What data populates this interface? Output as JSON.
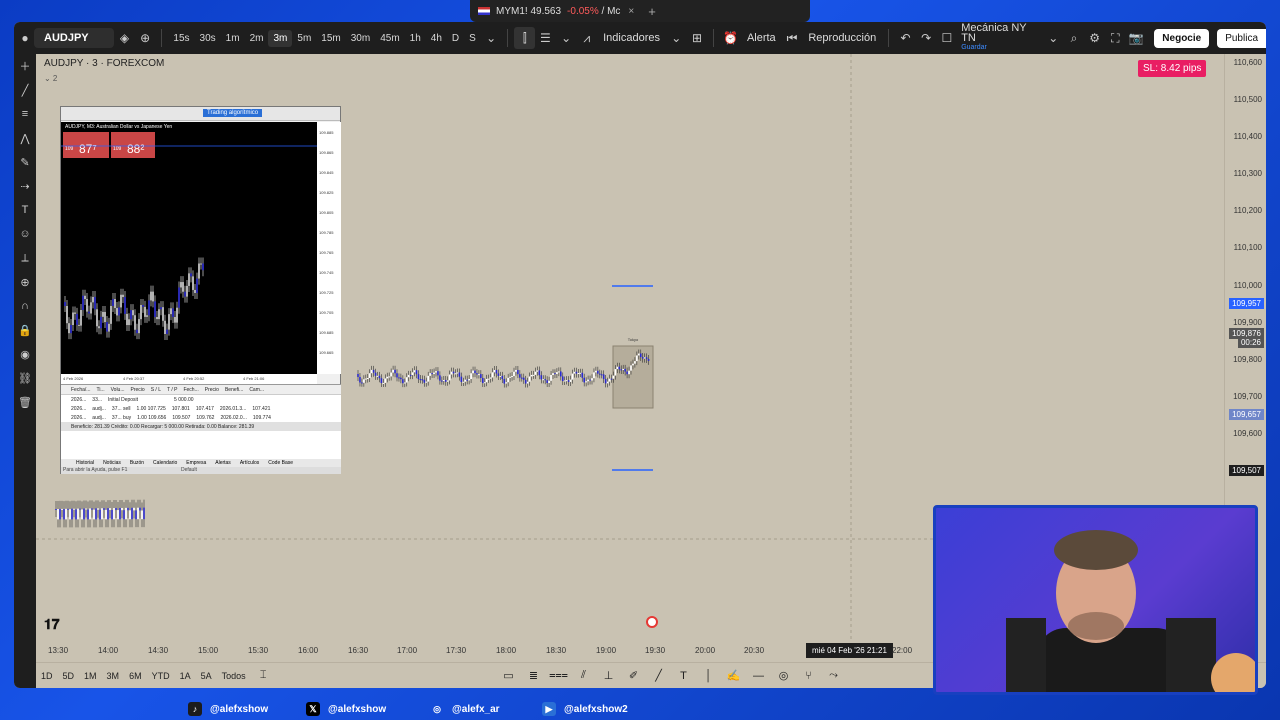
{
  "browser_tab": {
    "title": "MYM1!",
    "price": "49.563",
    "change": "-0.05%",
    "extra": "/ Mc",
    "close": "×",
    "new_tab": "+"
  },
  "toolbar": {
    "symbol": "AUDJPY",
    "timeframes": [
      "15s",
      "30s",
      "1m",
      "2m",
      "3m",
      "5m",
      "15m",
      "30m",
      "45m",
      "1h",
      "4h",
      "D",
      "S"
    ],
    "active_timeframe_index": 4,
    "indicators_label": "Indicadores",
    "alert_label": "Alerta",
    "replay_label": "Reproducción",
    "layout_name": "Mecánica NY TN",
    "layout_sub": "Guardar",
    "trade_label": "Negocie",
    "publish_label": "Publica"
  },
  "chart": {
    "legend": "AUDJPY · 3 · FOREXCOM",
    "legend_sub": "⌄ 2",
    "sl_badge": "SL: 8.42 pips",
    "session_label": "Tokyo",
    "accent_color": "#2962ff",
    "badge_color": "#e91e63"
  },
  "price_axis": {
    "labels": [
      "110,600",
      "110,500",
      "110,400",
      "110,300",
      "110,200",
      "110,100",
      "110,000",
      "109,900",
      "109,800",
      "109,700",
      "109,600"
    ],
    "tags": [
      {
        "text": "109,957",
        "color": "#2962ff"
      },
      {
        "text": "109,876",
        "color": "#555555"
      },
      {
        "text": "00:26",
        "color": "#555555"
      },
      {
        "text": "109,657",
        "color": "#6f86c9"
      },
      {
        "text": "109,507",
        "color": "#1e1e1e"
      }
    ]
  },
  "time_axis": {
    "labels": [
      "13:30",
      "14:00",
      "14:30",
      "15:00",
      "15:30",
      "16:00",
      "16:30",
      "17:00",
      "17:30",
      "18:00",
      "18:30",
      "19:00",
      "19:30",
      "20:00",
      "20:30",
      "22:00"
    ],
    "cursor_label": "mié 04 Feb '26   21:21"
  },
  "bottom_bar": {
    "ranges": [
      "1D",
      "5D",
      "1M",
      "3M",
      "6M",
      "YTD",
      "1A",
      "5A",
      "Todos"
    ]
  },
  "mt4": {
    "algo_button": "Trading algorítmico",
    "chart_title": "AUDJPY, M3: Australian Dollar vs Japanese Yen",
    "sell_label": "SELL",
    "buy_label": "BUY",
    "lot": "1.00",
    "sell_price_small": "109",
    "sell_price_big": "87⁷",
    "buy_price_small": "109",
    "buy_price_big": "88²",
    "axis": [
      "109.885",
      "109.865",
      "109.845",
      "109.825",
      "109.805",
      "109.785",
      "109.765",
      "109.745",
      "109.725",
      "109.705",
      "109.685",
      "109.665"
    ],
    "time_labels": [
      "4 Feb 2026",
      "4 Feb 20:37",
      "4 Feb 20:52",
      "4 Feb 21:06"
    ],
    "term_headers": [
      "Fecha/...",
      "Ti...",
      "Volu...",
      "Precio",
      "S / L",
      "T / P",
      "Fech...",
      "Precio",
      "Benefi...",
      "Cam..."
    ],
    "rows": [
      [
        "2026...",
        "33...",
        "Initial Deposit",
        "",
        "",
        "",
        "",
        "",
        "5 000.00",
        ""
      ],
      [
        "2026...",
        "audj...",
        "37... sell",
        "1.00 107.725",
        "107.801",
        "107.417",
        "2026.01.3...",
        "107.421",
        "",
        ""
      ],
      [
        "2026...",
        "audj...",
        "37... buy",
        "1.00 109.656",
        "109.507",
        "109.762",
        "2026.02.0...",
        "109.774",
        "",
        ""
      ]
    ],
    "balance_row": "Beneficio: 281.39  Crédito: 0.00  Recargar: 5 000.00  Retirada: 0.00  Balance:  281.39",
    "tabs": [
      "Historial",
      "Noticias",
      "Buzón",
      "Calendario",
      "Empresa",
      "Alertas",
      "Artículos",
      "Code Base"
    ],
    "status": "Para abrir la Ayuda, pulse F1",
    "status_right": "Default"
  },
  "social": [
    {
      "handle": "@alefxshow",
      "icon": "tiktok-icon"
    },
    {
      "handle": "@alefxshow",
      "icon": "x-icon"
    },
    {
      "handle": "@alefx_ar",
      "icon": "instagram-icon"
    },
    {
      "handle": "@alefxshow2",
      "icon": "youtube-icon"
    }
  ]
}
